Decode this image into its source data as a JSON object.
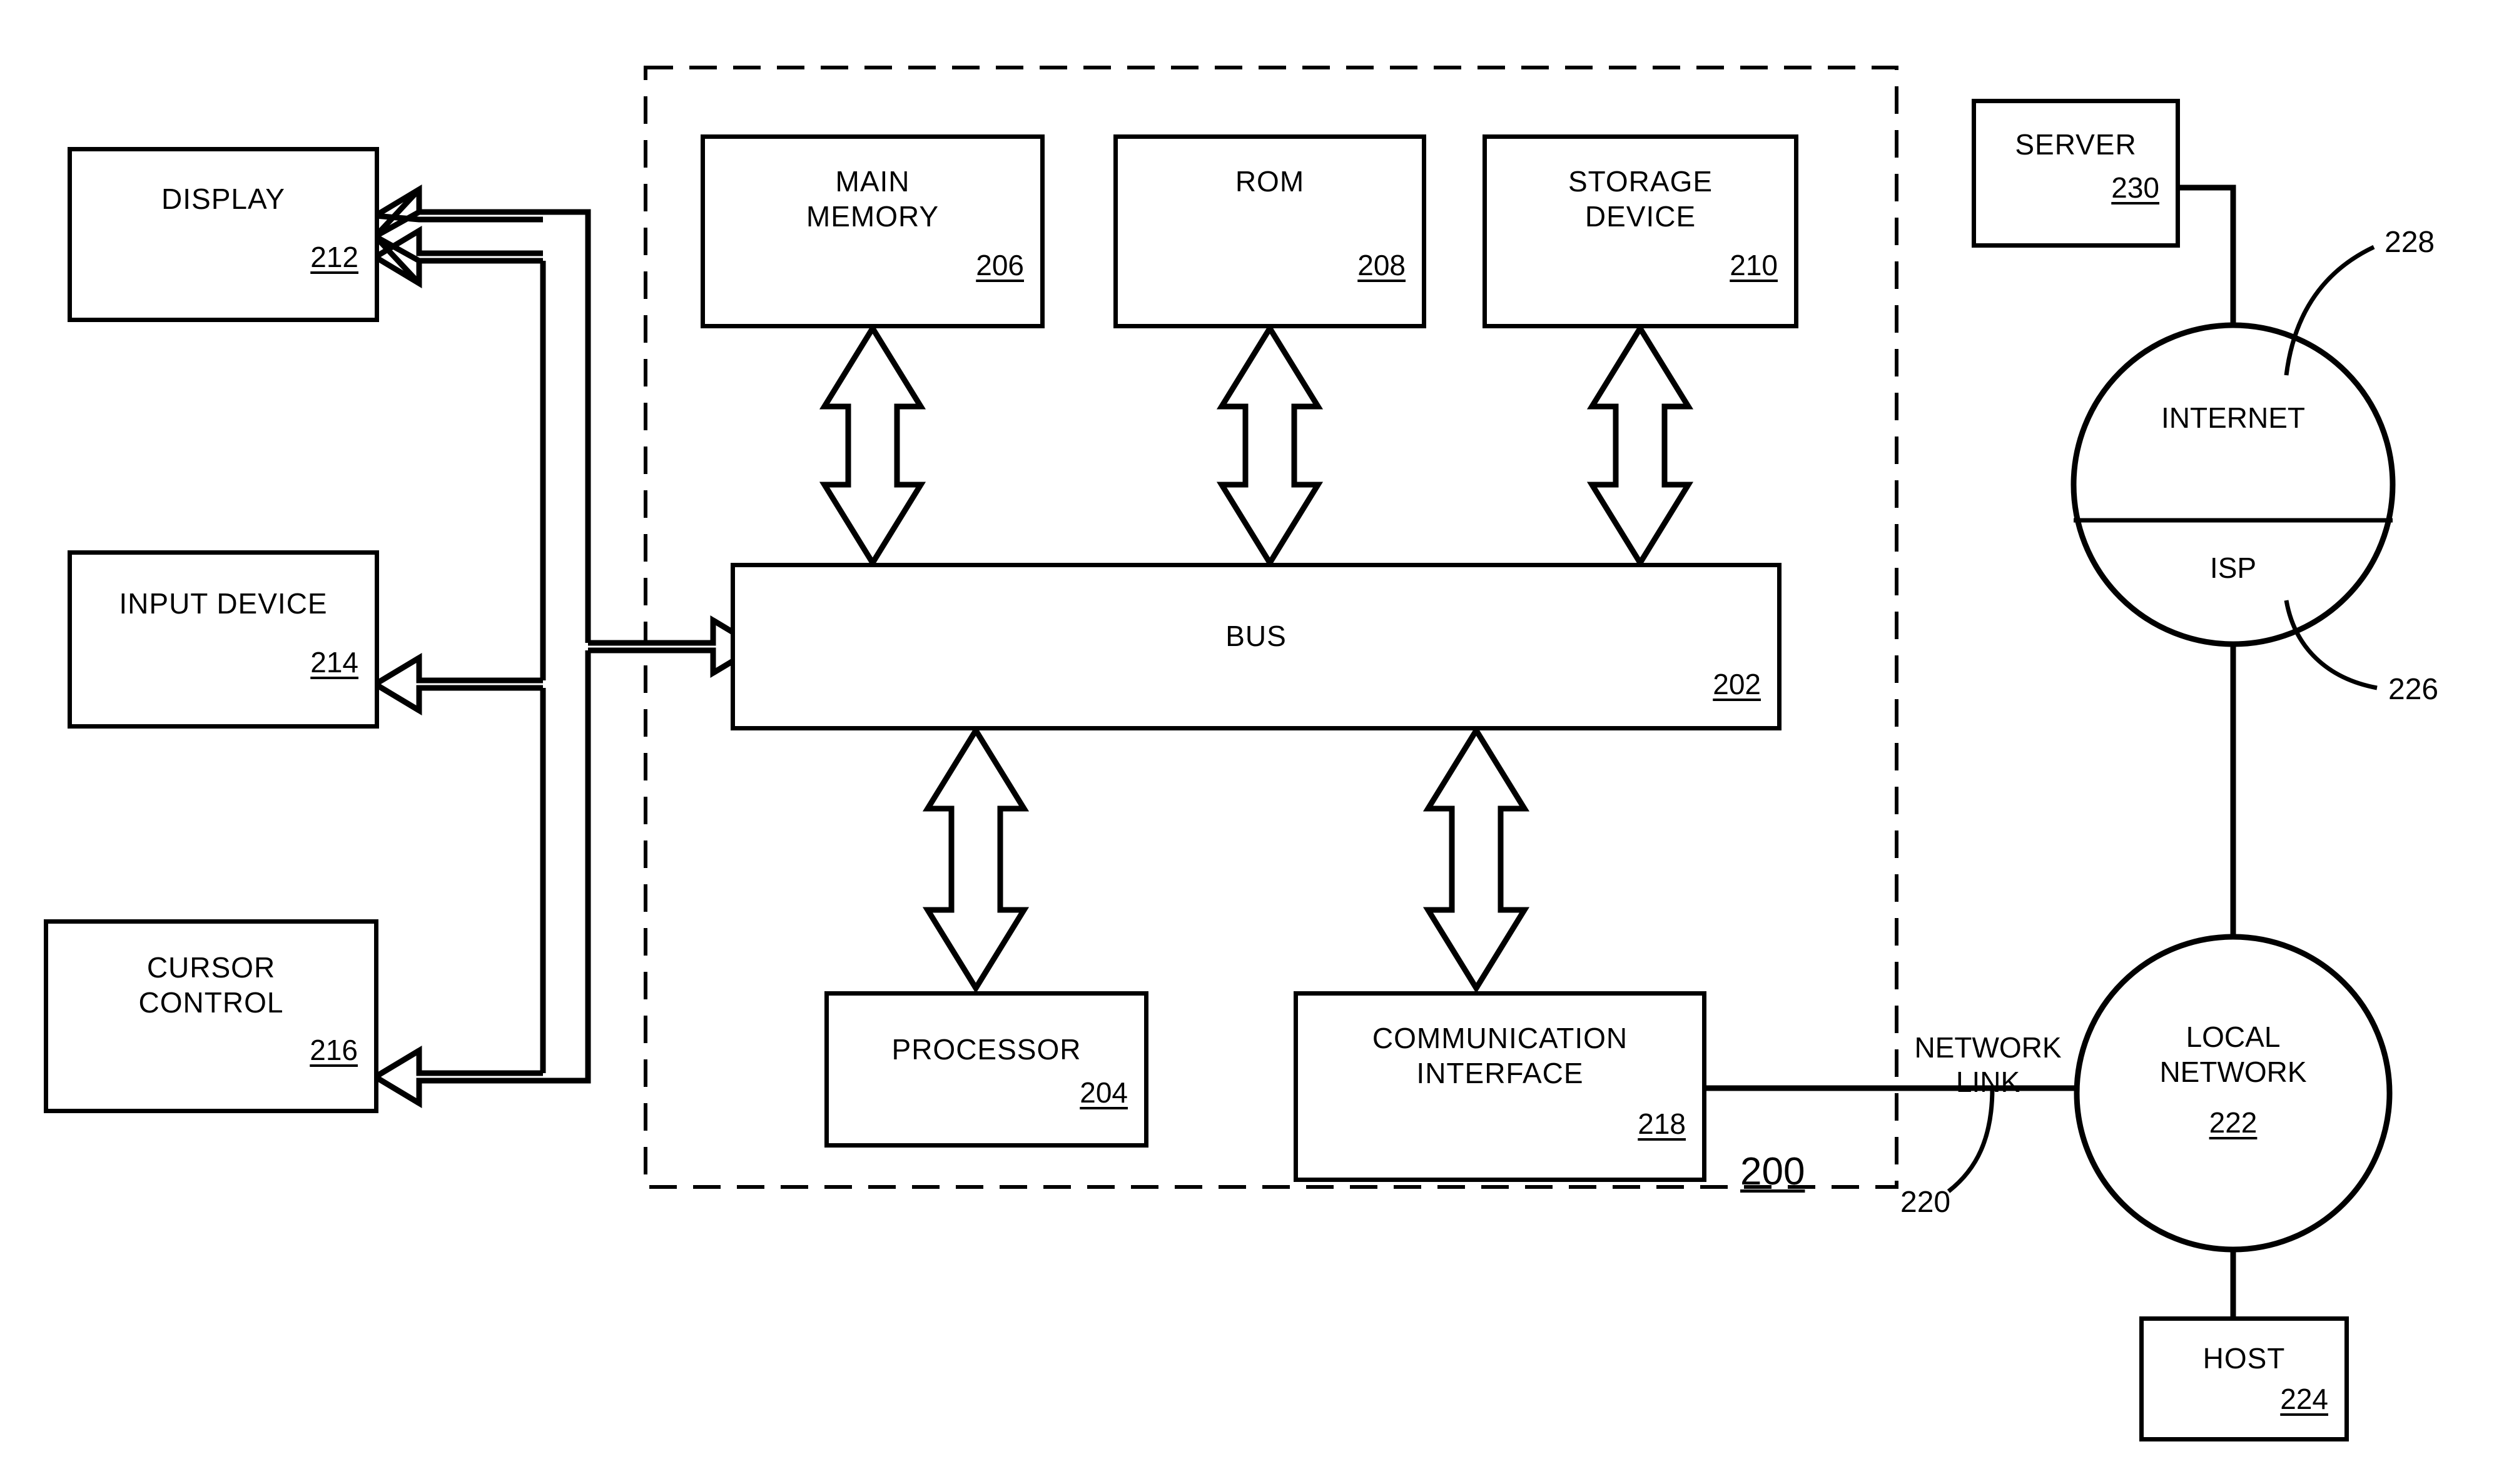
{
  "figure": {
    "system_ref": "200",
    "dashed_boundary": true
  },
  "blocks": [
    {
      "id": "display",
      "label": "DISPLAY",
      "ref": "212"
    },
    {
      "id": "input",
      "label": "INPUT DEVICE",
      "ref": "214"
    },
    {
      "id": "cursor",
      "label": "CURSOR\nCONTROL",
      "ref": "216"
    },
    {
      "id": "mainmem",
      "label": "MAIN\nMEMORY",
      "ref": "206"
    },
    {
      "id": "rom",
      "label": "ROM",
      "ref": "208"
    },
    {
      "id": "storage",
      "label": "STORAGE\nDEVICE",
      "ref": "210"
    },
    {
      "id": "bus",
      "label": "BUS",
      "ref": "202"
    },
    {
      "id": "processor",
      "label": "PROCESSOR",
      "ref": "204"
    },
    {
      "id": "comm",
      "label": "COMMUNICATION\nINTERFACE",
      "ref": "218"
    },
    {
      "id": "server",
      "label": "SERVER",
      "ref": "230"
    },
    {
      "id": "host",
      "label": "HOST",
      "ref": "224"
    }
  ],
  "clouds": [
    {
      "id": "internet",
      "top_label": "INTERNET",
      "bottom_label": "ISP",
      "upper_ref": "228",
      "lower_ref": "226"
    },
    {
      "id": "localnet",
      "label": "LOCAL\nNETWORK",
      "ref": "222"
    }
  ],
  "connections": {
    "network_link_label": "NETWORK\nLINK",
    "network_link_ref": "220"
  }
}
